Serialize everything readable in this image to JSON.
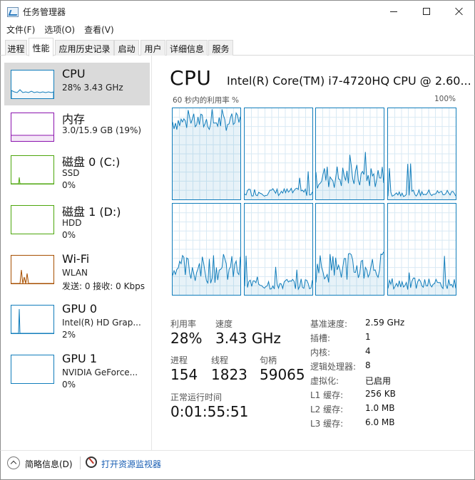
{
  "window": {
    "title": "任务管理器"
  },
  "menu": [
    "文件(F)",
    "选项(O)",
    "查看(V)"
  ],
  "tabs": [
    "进程",
    "性能",
    "应用历史记录",
    "启动",
    "用户",
    "详细信息",
    "服务"
  ],
  "active_tab": "性能",
  "sidebar": [
    {
      "title": "CPU",
      "line1": "28% 3.43 GHz",
      "line2": "",
      "color": "#117dbb",
      "selected": true
    },
    {
      "title": "内存",
      "line1": "3.0/15.9 GB (19%)",
      "line2": "",
      "color": "#8b12ae",
      "selected": false
    },
    {
      "title": "磁盘 0 (C:)",
      "line1": "SSD",
      "line2": "0%",
      "color": "#4da60c",
      "selected": false
    },
    {
      "title": "磁盘 1 (D:)",
      "line1": "HDD",
      "line2": "0%",
      "color": "#4da60c",
      "selected": false
    },
    {
      "title": "Wi-Fi",
      "line1": "WLAN",
      "line2": "发送: 0 接收: 0 Kbps",
      "color": "#a74f01",
      "selected": false
    },
    {
      "title": "GPU 0",
      "line1": "Intel(R) HD Grap...",
      "line2": "2%",
      "color": "#117dbb",
      "selected": false
    },
    {
      "title": "GPU 1",
      "line1": "NVIDIA GeForce...",
      "line2": "0%",
      "color": "#117dbb",
      "selected": false
    }
  ],
  "cpu": {
    "heading": "CPU",
    "model": "Intel(R) Core(TM) i7-4720HQ CPU @ 2.60...",
    "graph_label": "60 秒内的利用率 %",
    "graph_max": "100%",
    "stats": {
      "util_label": "利用率",
      "util_value": "28%",
      "speed_label": "速度",
      "speed_value": "3.43 GHz",
      "proc_label": "进程",
      "proc_value": "154",
      "thread_label": "线程",
      "thread_value": "1823",
      "handle_label": "句柄",
      "handle_value": "59065",
      "uptime_label": "正常运行时间",
      "uptime_value": "0:01:55:51"
    },
    "details": [
      {
        "label": "基准速度:",
        "value": "2.59 GHz"
      },
      {
        "label": "插槽:",
        "value": "1"
      },
      {
        "label": "内核:",
        "value": "4"
      },
      {
        "label": "逻辑处理器:",
        "value": "8"
      },
      {
        "label": "虚拟化:",
        "value": "已启用"
      },
      {
        "label": "L1 缓存:",
        "value": "256 KB"
      },
      {
        "label": "L2 缓存:",
        "value": "1.0 MB"
      },
      {
        "label": "L3 缓存:",
        "value": "6.0 MB"
      }
    ],
    "core_levels": [
      0.85,
      0.08,
      0.25,
      0.07,
      0.28,
      0.12,
      0.3,
      0.12
    ]
  },
  "footer": {
    "summary": "简略信息(D)",
    "monitor": "打开资源监视器"
  },
  "colors": {
    "accent": "#117dbb",
    "selected_bg": "#dadada",
    "link": "#1a5fb4"
  }
}
